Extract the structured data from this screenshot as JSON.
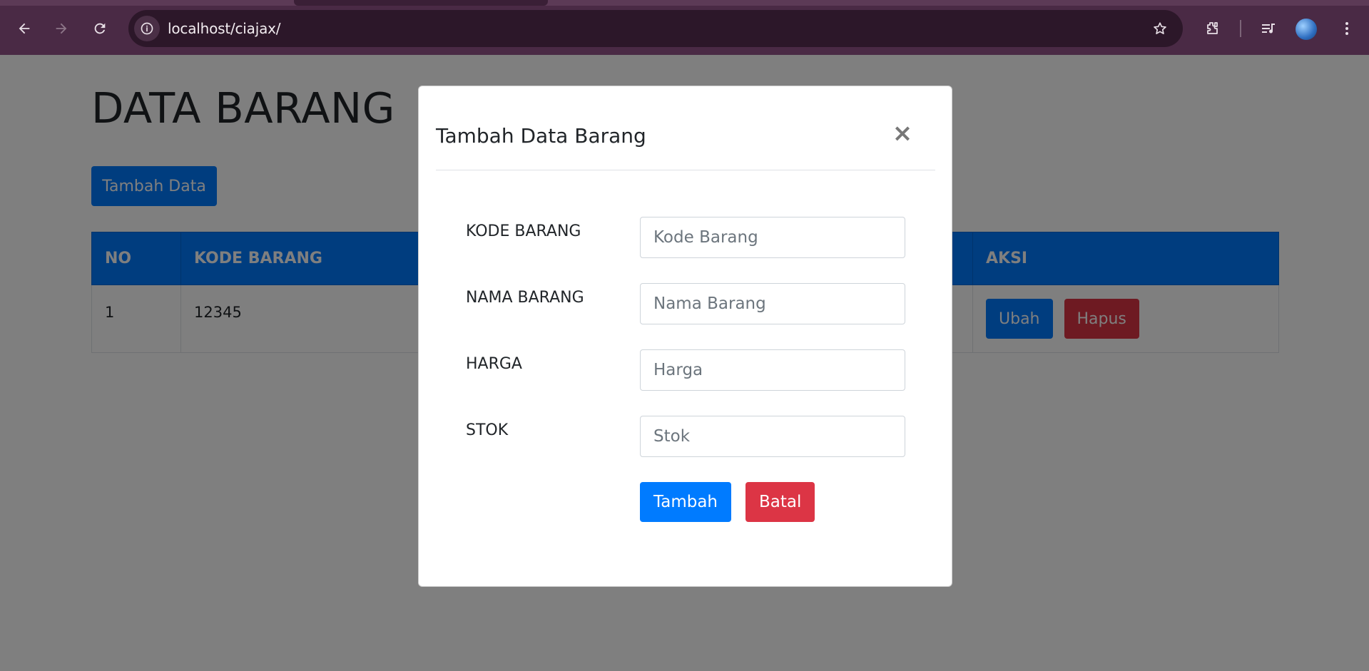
{
  "browser": {
    "url": "localhost/ciajax/"
  },
  "page": {
    "title": "DATA BARANG",
    "add_button": "Tambah Data",
    "table": {
      "headers": [
        "NO",
        "KODE BARANG",
        "AKSI"
      ],
      "rows": [
        {
          "no": "1",
          "kode": "12345",
          "edit_label": "Ubah",
          "delete_label": "Hapus"
        }
      ]
    }
  },
  "modal": {
    "title": "Tambah Data Barang",
    "close_symbol": "×",
    "fields": [
      {
        "label": "KODE BARANG",
        "placeholder": "Kode Barang",
        "value": ""
      },
      {
        "label": "NAMA BARANG",
        "placeholder": "Nama Barang",
        "value": ""
      },
      {
        "label": "HARGA",
        "placeholder": "Harga",
        "value": ""
      },
      {
        "label": "STOK",
        "placeholder": "Stok",
        "value": ""
      }
    ],
    "submit_label": "Tambah",
    "cancel_label": "Batal"
  },
  "colors": {
    "primary": "#007bff",
    "danger": "#dc3545",
    "chrome": "#4a2a45"
  }
}
